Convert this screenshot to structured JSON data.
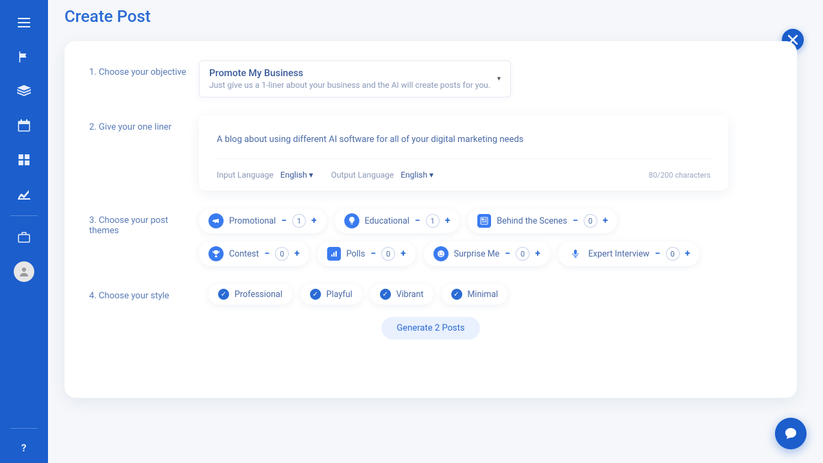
{
  "page_title": "Create Post",
  "steps": {
    "s1": "1. Choose your objective",
    "s2": "2. Give your one liner",
    "s3": "3. Choose your post themes",
    "s4": "4. Choose your style"
  },
  "objective": {
    "title": "Promote My Business",
    "subtitle": "Just give us a 1-liner about your business and the AI will create posts for you."
  },
  "liner": {
    "value": "A blog about using different AI software for all of your digital marketing needs",
    "input_lang_label": "Input Language",
    "input_lang": "English",
    "output_lang_label": "Output Language",
    "output_lang": "English",
    "count": "80/200 characters"
  },
  "themes": [
    {
      "label": "Promotional",
      "count": "1"
    },
    {
      "label": "Educational",
      "count": "1"
    },
    {
      "label": "Behind the Scenes",
      "count": "0"
    },
    {
      "label": "Contest",
      "count": "0"
    },
    {
      "label": "Polls",
      "count": "0"
    },
    {
      "label": "Surprise Me",
      "count": "0"
    },
    {
      "label": "Expert Interview",
      "count": "0"
    }
  ],
  "styles": [
    {
      "label": "Professional"
    },
    {
      "label": "Vibrant"
    },
    {
      "label": "Playful"
    },
    {
      "label": "Minimal"
    }
  ],
  "generate_label": "Generate 2 Posts"
}
